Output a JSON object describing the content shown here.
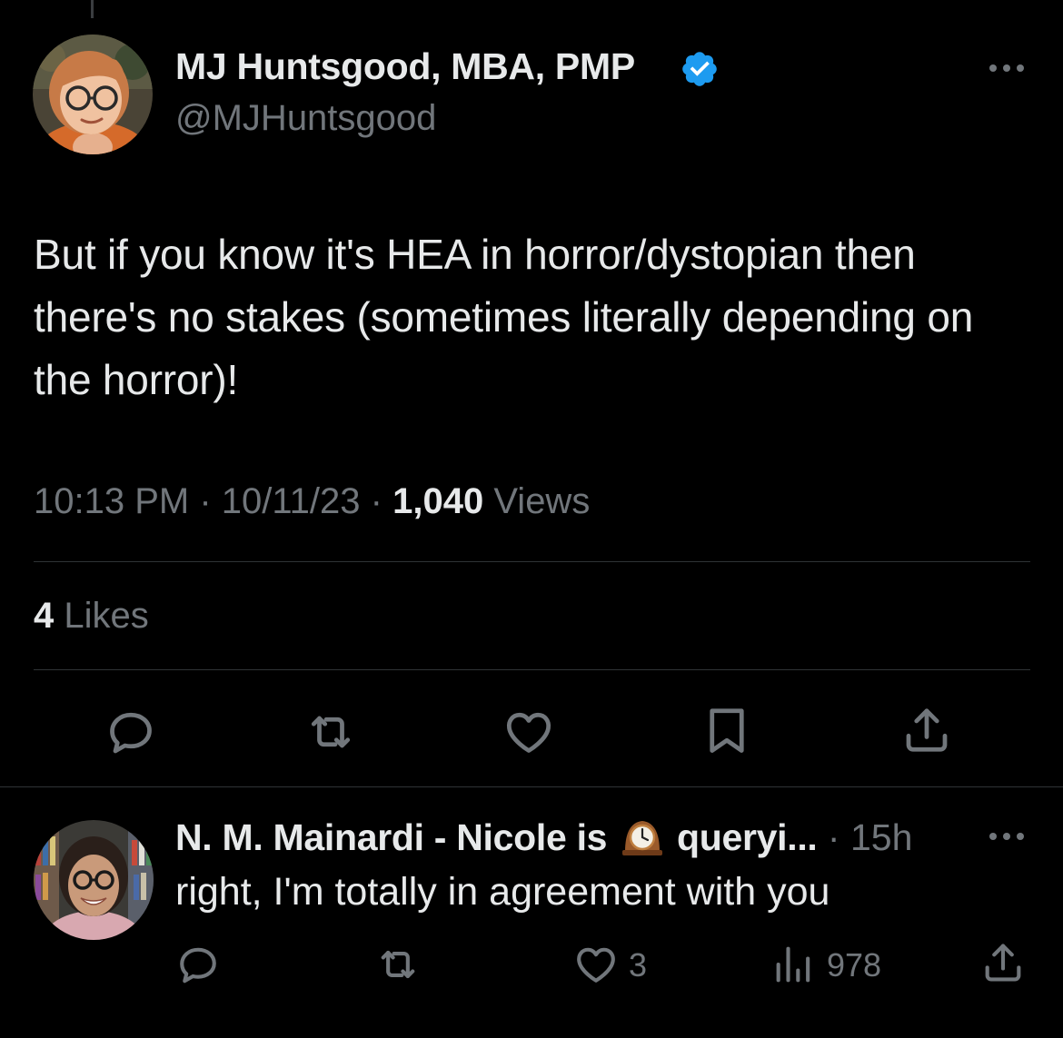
{
  "tweet": {
    "author_name": "MJ Huntsgood, MBA, PMP",
    "author_handle": "@MJHuntsgood",
    "text": "But if you know it's HEA in horror/dystopian then there's no stakes (sometimes literally depending on the horror)!",
    "time": "10:13 PM",
    "date": "10/11/23",
    "separator": "·",
    "views_count": "1,040",
    "views_label": "Views",
    "likes_count": "4",
    "likes_label": "Likes",
    "verified_color": "#1d9bf0"
  },
  "actions": {
    "icons": [
      "reply-icon",
      "retweet-icon",
      "like-icon",
      "bookmark-icon",
      "share-icon"
    ],
    "icon_color": "#71767b"
  },
  "reply": {
    "author_name_part1": "N. M. Mainardi - Nicole is",
    "author_name_emoji": "mantelpiece-clock-icon",
    "author_name_part2": "queryi...",
    "separator": "·",
    "time": "15h",
    "text": "right, I'm totally in agreement with you",
    "like_count": "3",
    "view_count": "978"
  },
  "colors": {
    "background": "#000000",
    "primary_text": "#e7e9ea",
    "secondary_text": "#71767b",
    "divider": "#2f3336"
  }
}
